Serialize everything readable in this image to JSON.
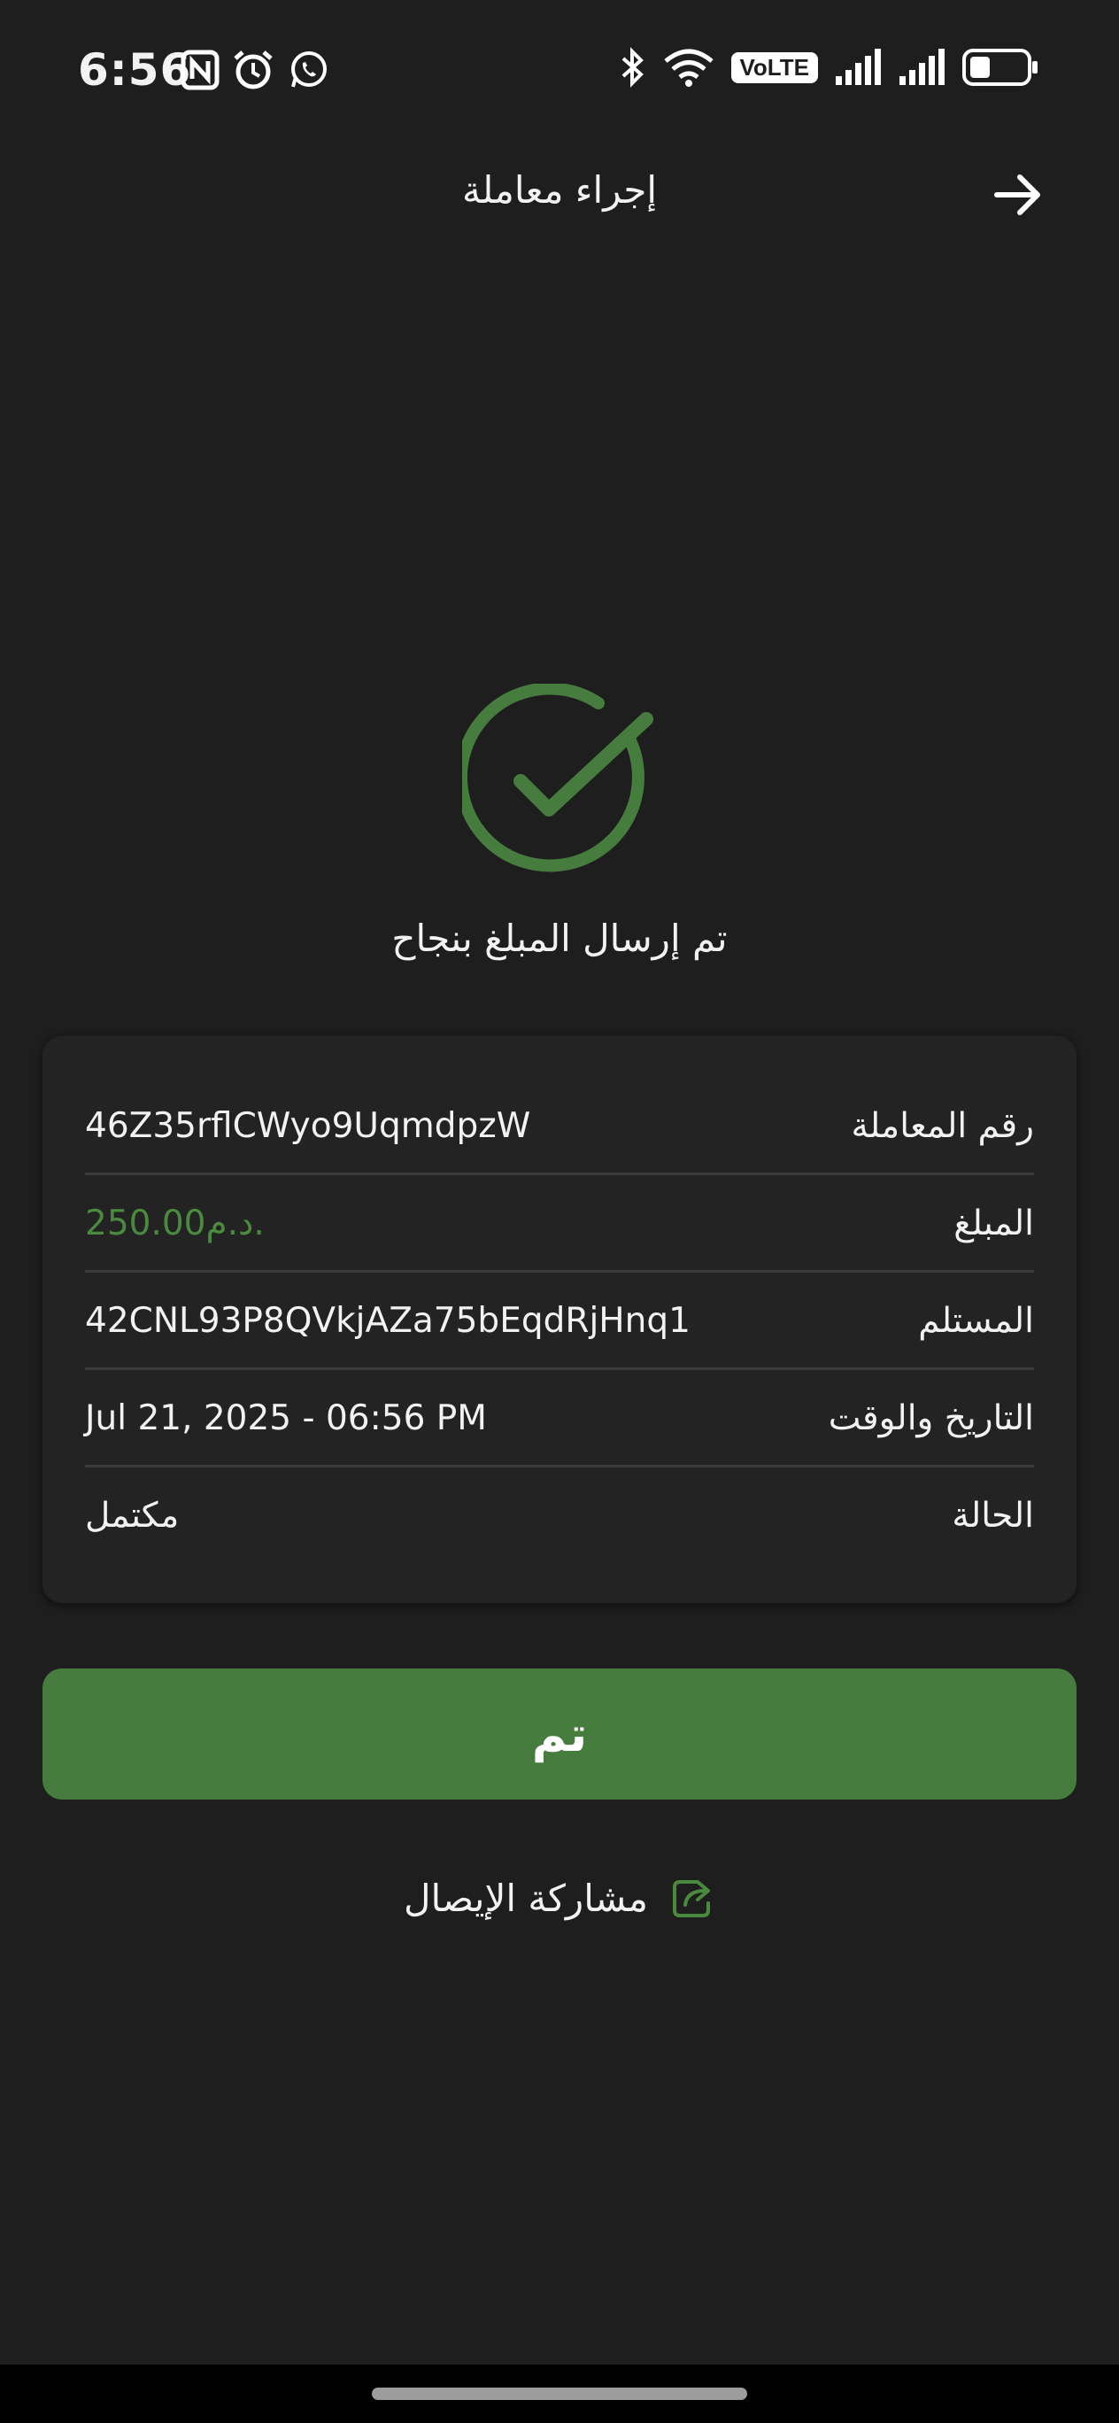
{
  "status_bar": {
    "time": "6:56",
    "left_icons": [
      "nfc-icon",
      "alarm-icon",
      "whatsapp-icon"
    ],
    "right_icons": [
      "bluetooth-icon",
      "wifi-icon",
      "volte-icon",
      "signal-icon",
      "signal-icon",
      "battery-icon"
    ],
    "volte_label": "VoLTE",
    "battery_level_percent": 35
  },
  "header": {
    "title": "إجراء معاملة",
    "back_icon": "arrow-right-icon"
  },
  "success": {
    "icon": "check-circle-icon",
    "message": "تم إرسال المبلغ بنجاح"
  },
  "details": {
    "rows": [
      {
        "label": "رقم المعاملة",
        "value": "46Z35rflCWyo9UqmdpzW"
      },
      {
        "label": "المبلغ",
        "value": "250.00د.م."
      },
      {
        "label": "المستلم",
        "value": "42CNL93P8QVkjAZa75bEqdRjHnq1"
      },
      {
        "label": "التاريخ والوقت",
        "value": "Jul 21, 2025 - 06:56 PM"
      },
      {
        "label": "الحالة",
        "value": "مكتمل"
      }
    ]
  },
  "done_button": {
    "label": "تم"
  },
  "share": {
    "label": "مشاركة الإيصال",
    "icon": "share-icon"
  },
  "colors": {
    "background": "#1e1e1e",
    "card": "#232323",
    "accent_green": "#467c3e",
    "amount_green": "#4a8a3f",
    "text": "#f2f2f2"
  }
}
